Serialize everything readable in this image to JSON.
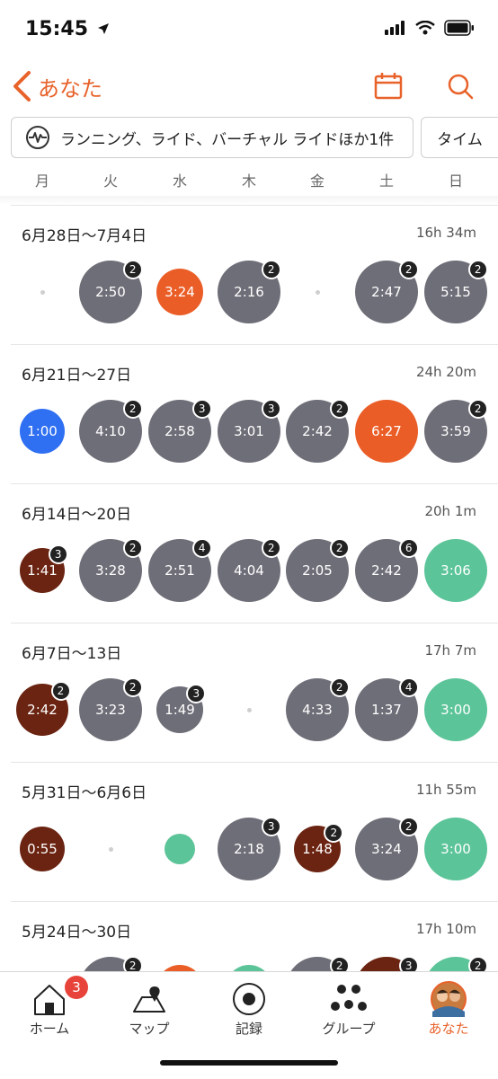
{
  "status_bar": {
    "time": "15:45"
  },
  "nav": {
    "back_label": "あなた"
  },
  "filter": {
    "sport_label": "ランニング、ライド、バーチャル ライドほか1件",
    "metric_label": "タイム"
  },
  "days": [
    "月",
    "火",
    "水",
    "木",
    "金",
    "土",
    "日"
  ],
  "colors": {
    "accent": "#e8622a",
    "gray": "#6e6e78",
    "orange": "#ea5d27",
    "blue": "#2f6ff2",
    "brown": "#6b2411",
    "green": "#5cc499"
  },
  "weeks": [
    {
      "label": "6月28日〜7月4日",
      "total": "16h 34m",
      "days": [
        {
          "type": "dot"
        },
        {
          "type": "bubble",
          "color": "gray",
          "text": "2:50",
          "badge": "2",
          "size": "l"
        },
        {
          "type": "bubble",
          "color": "orange",
          "text": "3:24",
          "size": "m"
        },
        {
          "type": "bubble",
          "color": "gray",
          "text": "2:16",
          "badge": "2",
          "size": "l"
        },
        {
          "type": "dot"
        },
        {
          "type": "bubble",
          "color": "gray",
          "text": "2:47",
          "badge": "2",
          "size": "l"
        },
        {
          "type": "bubble",
          "color": "gray",
          "text": "5:15",
          "badge": "2",
          "size": "l"
        }
      ]
    },
    {
      "label": "6月21日〜27日",
      "total": "24h 20m",
      "days": [
        {
          "type": "bubble",
          "color": "blue",
          "text": "1:00",
          "size": "s"
        },
        {
          "type": "bubble",
          "color": "gray",
          "text": "4:10",
          "badge": "2",
          "size": "l"
        },
        {
          "type": "bubble",
          "color": "gray",
          "text": "2:58",
          "badge": "3",
          "size": "l"
        },
        {
          "type": "bubble",
          "color": "gray",
          "text": "3:01",
          "badge": "3",
          "size": "l"
        },
        {
          "type": "bubble",
          "color": "gray",
          "text": "2:42",
          "badge": "2",
          "size": "l"
        },
        {
          "type": "bubble",
          "color": "orange",
          "text": "6:27",
          "size": "l"
        },
        {
          "type": "bubble",
          "color": "gray",
          "text": "3:59",
          "badge": "2",
          "size": "l"
        }
      ]
    },
    {
      "label": "6月14日〜20日",
      "total": "20h  1m",
      "days": [
        {
          "type": "bubble",
          "color": "brown",
          "text": "1:41",
          "badge": "3",
          "size": "s"
        },
        {
          "type": "bubble",
          "color": "gray",
          "text": "3:28",
          "badge": "2",
          "size": "l"
        },
        {
          "type": "bubble",
          "color": "gray",
          "text": "2:51",
          "badge": "4",
          "size": "l"
        },
        {
          "type": "bubble",
          "color": "gray",
          "text": "4:04",
          "badge": "2",
          "size": "l"
        },
        {
          "type": "bubble",
          "color": "gray",
          "text": "2:05",
          "badge": "2",
          "size": "l"
        },
        {
          "type": "bubble",
          "color": "gray",
          "text": "2:42",
          "badge": "6",
          "size": "l"
        },
        {
          "type": "bubble",
          "color": "green",
          "text": "3:06",
          "size": "l"
        }
      ]
    },
    {
      "label": "6月7日〜13日",
      "total": "17h  7m",
      "days": [
        {
          "type": "bubble",
          "color": "brown",
          "text": "2:42",
          "badge": "2",
          "size": "ml"
        },
        {
          "type": "bubble",
          "color": "gray",
          "text": "3:23",
          "badge": "2",
          "size": "l"
        },
        {
          "type": "bubble",
          "color": "gray",
          "text": "1:49",
          "badge": "3",
          "size": "m"
        },
        {
          "type": "dot"
        },
        {
          "type": "bubble",
          "color": "gray",
          "text": "4:33",
          "badge": "2",
          "size": "l"
        },
        {
          "type": "bubble",
          "color": "gray",
          "text": "1:37",
          "badge": "4",
          "size": "l"
        },
        {
          "type": "bubble",
          "color": "green",
          "text": "3:00",
          "size": "l"
        }
      ]
    },
    {
      "label": "5月31日〜6月6日",
      "total": "11h 55m",
      "days": [
        {
          "type": "bubble",
          "color": "brown",
          "text": "0:55",
          "size": "s"
        },
        {
          "type": "dot"
        },
        {
          "type": "bubble",
          "color": "green",
          "text": "",
          "size": "xs"
        },
        {
          "type": "bubble",
          "color": "gray",
          "text": "2:18",
          "badge": "3",
          "size": "l"
        },
        {
          "type": "bubble",
          "color": "brown",
          "text": "1:48",
          "badge": "2",
          "size": "m"
        },
        {
          "type": "bubble",
          "color": "gray",
          "text": "3:24",
          "badge": "2",
          "size": "l"
        },
        {
          "type": "bubble",
          "color": "green",
          "text": "3:00",
          "size": "l"
        }
      ]
    },
    {
      "label": "5月24日〜30日",
      "total": "17h 10m",
      "days": [
        {
          "type": "none"
        },
        {
          "type": "bubble",
          "color": "gray",
          "text": "",
          "badge": "2",
          "size": "l"
        },
        {
          "type": "bubble",
          "color": "orange",
          "text": "",
          "size": "m"
        },
        {
          "type": "bubble",
          "color": "green",
          "text": "",
          "size": "m"
        },
        {
          "type": "bubble",
          "color": "gray",
          "text": "",
          "badge": "2",
          "size": "l"
        },
        {
          "type": "bubble",
          "color": "brown",
          "text": "",
          "badge": "3",
          "size": "l"
        },
        {
          "type": "bubble",
          "color": "green",
          "text": "",
          "badge": "2",
          "size": "l"
        }
      ]
    }
  ],
  "tabs": [
    {
      "label": "ホーム",
      "icon": "home-icon",
      "badge": "3"
    },
    {
      "label": "マップ",
      "icon": "map-icon"
    },
    {
      "label": "記録",
      "icon": "record-icon"
    },
    {
      "label": "グループ",
      "icon": "groups-icon"
    },
    {
      "label": "あなた",
      "icon": "avatar-icon",
      "active": true
    }
  ]
}
